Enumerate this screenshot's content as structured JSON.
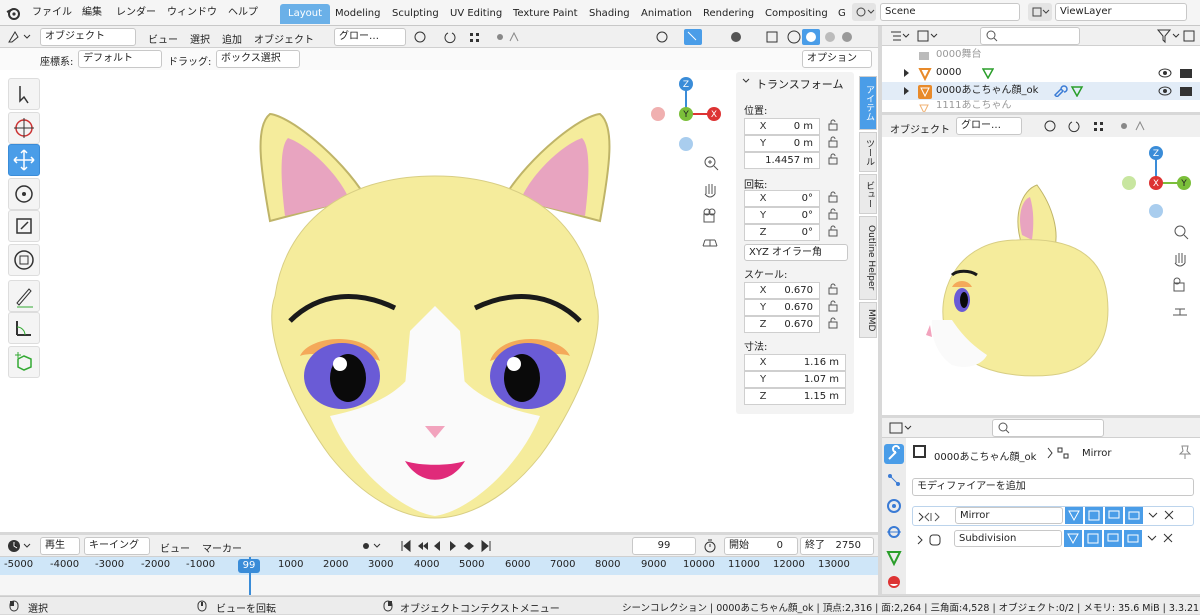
{
  "menu": [
    "ファイル",
    "編集",
    "レンダー",
    "ウィンドウ",
    "ヘルプ"
  ],
  "workspaces": [
    "Layout",
    "Modeling",
    "Sculpting",
    "UV Editing",
    "Texture Paint",
    "Shading",
    "Animation",
    "Rendering",
    "Compositing",
    "G"
  ],
  "scene_name": "Scene",
  "view_layer": "ViewLayer",
  "viewport": {
    "mode": "オブジェクト",
    "menus": [
      "ビュー",
      "選択",
      "追加",
      "オブジェクト"
    ],
    "transform_orient": "グロー…",
    "coord_label": "座標系:",
    "coord_value": "デフォルト",
    "drag_label": "ドラッグ:",
    "drag_value": "ボックス選択",
    "options": "オプション",
    "gizmo": {
      "z": "Z",
      "y": "Y",
      "x": "X"
    }
  },
  "npanel": {
    "title": "トランスフォーム",
    "location_label": "位置:",
    "location": [
      {
        "axis": "X",
        "value": "0 m"
      },
      {
        "axis": "Y",
        "value": "0 m"
      },
      {
        "axis": "Z",
        "value": "1.4457 m"
      }
    ],
    "rotation_label": "回転:",
    "rotation": [
      {
        "axis": "X",
        "value": "0°"
      },
      {
        "axis": "Y",
        "value": "0°"
      },
      {
        "axis": "Z",
        "value": "0°"
      }
    ],
    "rotation_mode": "XYZ オイラー角",
    "scale_label": "スケール:",
    "scale": [
      {
        "axis": "X",
        "value": "0.670"
      },
      {
        "axis": "Y",
        "value": "0.670"
      },
      {
        "axis": "Z",
        "value": "0.670"
      }
    ],
    "dims_label": "寸法:",
    "dims": [
      {
        "axis": "X",
        "value": "1.16 m"
      },
      {
        "axis": "Y",
        "value": "1.07 m"
      },
      {
        "axis": "Z",
        "value": "1.15 m"
      }
    ],
    "tabs": [
      "アイテム",
      "ツール",
      "ビュー",
      "Outline Helper",
      "MMD"
    ]
  },
  "outliner": {
    "items": [
      {
        "name": "0000舞台",
        "dim": true
      },
      {
        "name": "0000",
        "dim": false
      },
      {
        "name": "0000あこちゃん顔_ok",
        "dim": false
      },
      {
        "name": "1111あこちゃん",
        "dim": true
      }
    ]
  },
  "side_view": {
    "mode": "オブジェクト",
    "orient": "グロー…",
    "gizmo": {
      "z": "Z",
      "y": "Y",
      "x": "X"
    }
  },
  "properties": {
    "object": "0000あこちゃん顔_ok",
    "modifier_crumb": "Mirror",
    "add_modifier": "モディファイアーを追加",
    "modifiers": [
      "Mirror",
      "Subdivision"
    ]
  },
  "timeline": {
    "menus": [
      "再生",
      "キーイング",
      "ビュー",
      "マーカー"
    ],
    "current": "99",
    "start_label": "開始",
    "start": "0",
    "end_label": "終了",
    "end": "2750",
    "ticks": [
      "-5000",
      "-4000",
      "-3000",
      "-2000",
      "-1000",
      "99",
      "1000",
      "2000",
      "3000",
      "4000",
      "5000",
      "6000",
      "7000",
      "8000",
      "9000",
      "10000",
      "11000",
      "12000",
      "13000"
    ]
  },
  "status": {
    "select": "選択",
    "rotate": "ビューを回転",
    "context": "オブジェクトコンテクストメニュー",
    "stats": "シーンコレクション | 0000あこちゃん顔_ok | 頂点:2,316 | 面:2,264 | 三角面:4,528 | オブジェクト:0/2 | メモリ: 35.6 MiB | 3.3.21"
  },
  "colors": {
    "accent": "#4a9de8",
    "fur": "#f5ec9c",
    "ear_inner": "#e8a4c0",
    "eye": "#6a5bd6",
    "brow": "#1a1a1a"
  }
}
